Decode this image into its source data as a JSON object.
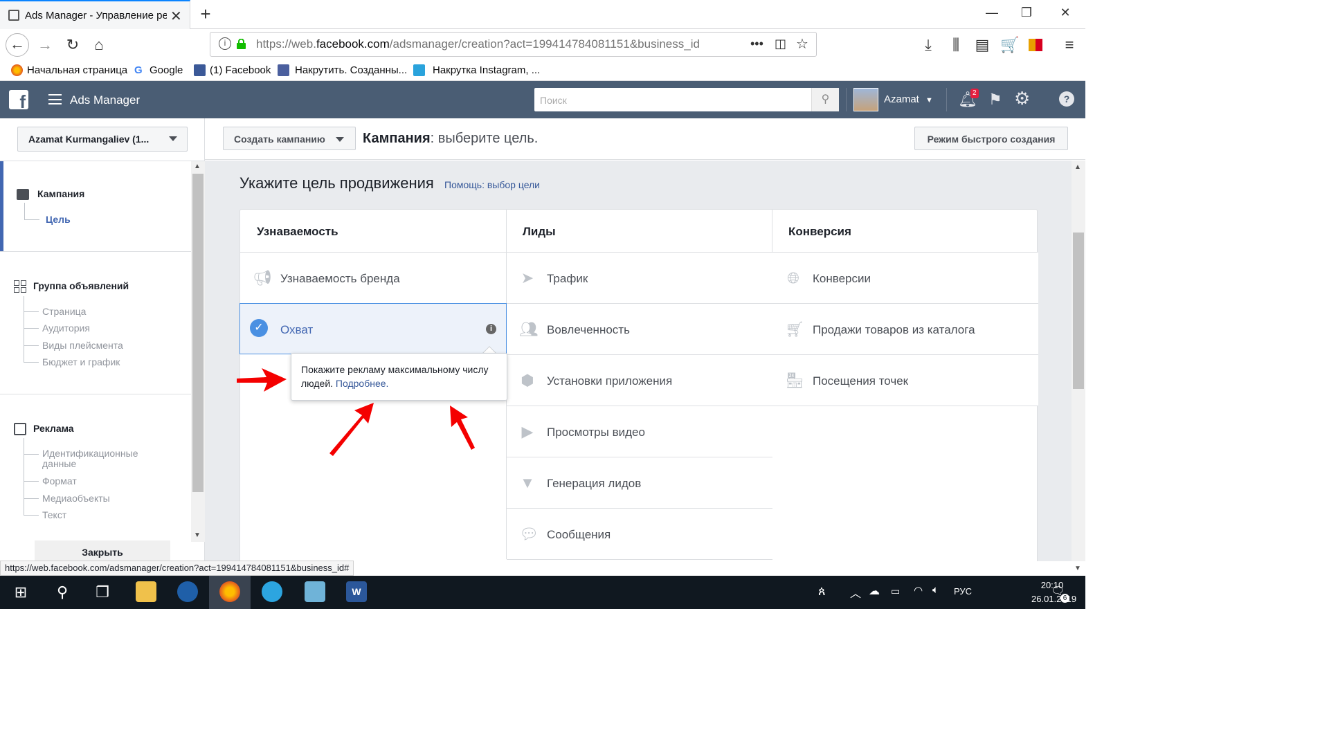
{
  "browser": {
    "tab_title": "Ads Manager - Управление ре",
    "url_prefix": "https://web.",
    "url_domain": "facebook.com",
    "url_rest": "/adsmanager/creation?act=199414784081151&business_id",
    "bookmarks": [
      {
        "label": "Начальная страница",
        "icon": "firefox-icon"
      },
      {
        "label": "Google",
        "icon": "google-icon"
      },
      {
        "label": "(1) Facebook",
        "icon": "facebook-icon"
      },
      {
        "label": "Накрутить. Созданны...",
        "icon": "bl-icon"
      },
      {
        "label": "Накрутка Instagram, ...",
        "icon": "instagram-icon"
      }
    ],
    "status_url": "https://web.facebook.com/adsmanager/creation?act=199414784081151&business_id#"
  },
  "fb_header": {
    "app_name": "Ads Manager",
    "search_placeholder": "Поиск",
    "user_name": "Azamat",
    "notifications_count": "2",
    "bg_color": "#4a5d74"
  },
  "sidebar": {
    "account": "Azamat Kurmangaliev (1...",
    "campaign": {
      "title": "Кампания",
      "items": [
        "Цель"
      ]
    },
    "adset": {
      "title": "Группа объявлений",
      "items": [
        "Страница",
        "Аудитория",
        "Виды плейсмента",
        "Бюджет и график"
      ]
    },
    "ad": {
      "title": "Реклама",
      "items": [
        "Идентификационные данные",
        "Формат",
        "Медиаобъекты",
        "Текст"
      ]
    },
    "close_label": "Закрыть"
  },
  "topbar": {
    "create_label": "Создать кампанию",
    "title_bold": "Кампания",
    "title_rest": ": выберите цель.",
    "quick_label": "Режим быстрого создания"
  },
  "main": {
    "heading": "Укажите цель продвижения",
    "help_link": "Помощь: выбор цели",
    "columns": [
      {
        "title": "Узнаваемость",
        "items": [
          {
            "label": "Узнаваемость бренда",
            "icon": "megaphone-icon"
          },
          {
            "label": "Охват",
            "icon": "check-icon",
            "selected": true
          }
        ]
      },
      {
        "title": "Лиды",
        "items": [
          {
            "label": "Трафик",
            "icon": "cursor-icon"
          },
          {
            "label": "Вовлеченность",
            "icon": "people-icon"
          },
          {
            "label": "Установки приложения",
            "icon": "box-icon"
          },
          {
            "label": "Просмотры видео",
            "icon": "video-icon"
          },
          {
            "label": "Генерация лидов",
            "icon": "funnel-icon"
          },
          {
            "label": "Сообщения",
            "icon": "chat-icon"
          }
        ]
      },
      {
        "title": "Конверсия",
        "items": [
          {
            "label": "Конверсии",
            "icon": "globe-icon"
          },
          {
            "label": "Продажи товаров из каталога",
            "icon": "cart-icon"
          },
          {
            "label": "Посещения точек",
            "icon": "store-icon"
          }
        ]
      }
    ],
    "tooltip_text": "Покажите рекламу максимальному числу людей.",
    "tooltip_link": "Подробнее."
  },
  "taskbar": {
    "lang": "РУС",
    "time": "20:10",
    "date": "26.01.2019",
    "notif_count": "6"
  }
}
